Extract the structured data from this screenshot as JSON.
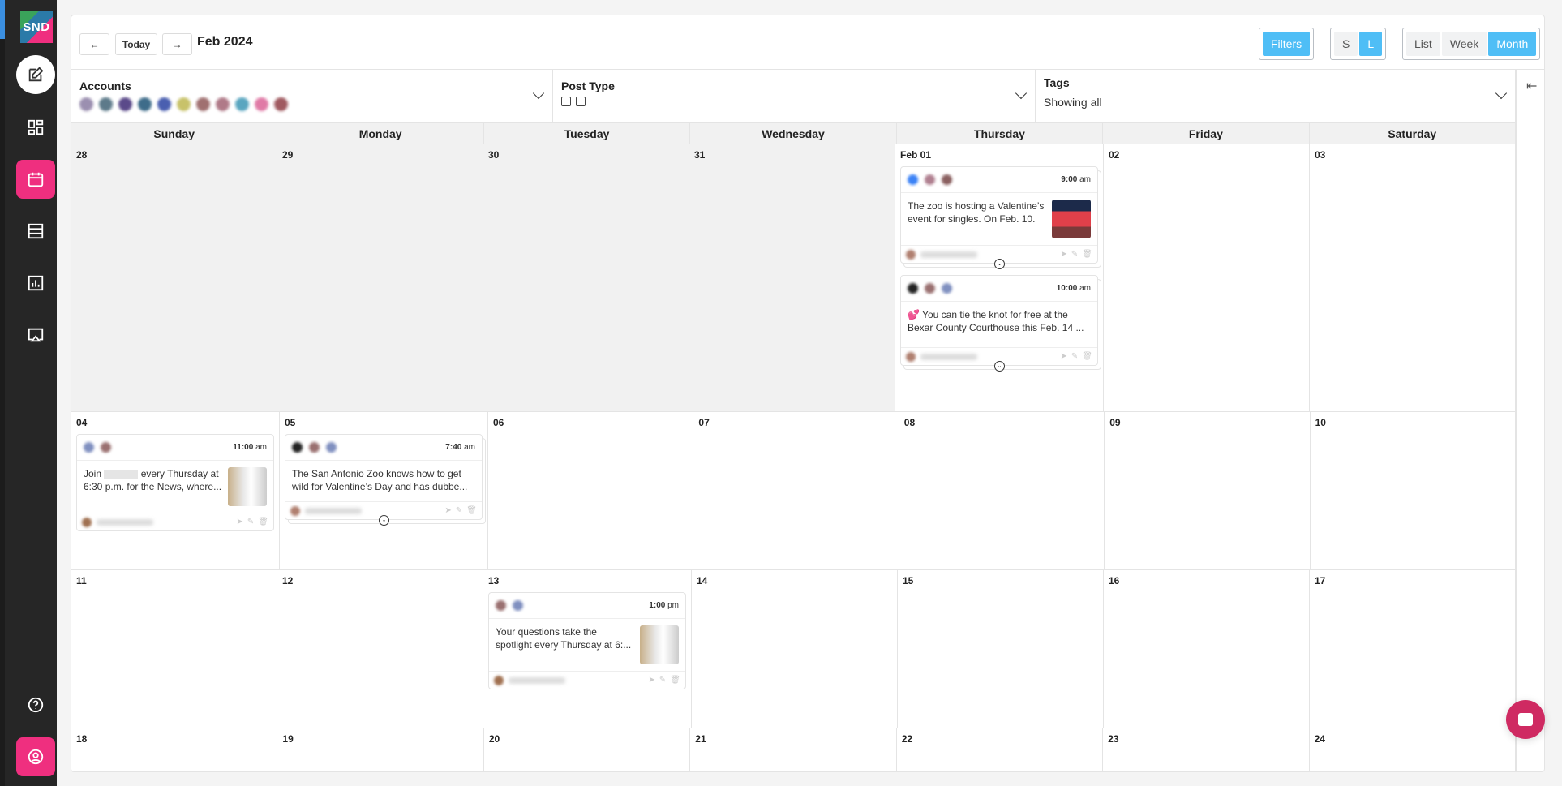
{
  "app": {
    "logo_text": "SND"
  },
  "sidebar": {
    "items": [
      {
        "name": "compose",
        "icon": "edit-icon"
      },
      {
        "name": "dashboard",
        "icon": "dashboard-icon"
      },
      {
        "name": "calendar",
        "icon": "calendar-icon",
        "active": true
      },
      {
        "name": "list",
        "icon": "list-icon"
      },
      {
        "name": "analytics",
        "icon": "chart-icon"
      },
      {
        "name": "screen",
        "icon": "cast-icon"
      },
      {
        "name": "help",
        "icon": "help-icon"
      },
      {
        "name": "profile",
        "icon": "user-icon"
      }
    ]
  },
  "toolbar": {
    "prev_label": "←",
    "today_label": "Today",
    "next_label": "→",
    "month_title": "Feb 2024",
    "filters_label": "Filters",
    "size": {
      "s": "S",
      "l": "L",
      "selected": "L"
    },
    "views": [
      "List",
      "Week",
      "Month"
    ],
    "selected_view": "Month"
  },
  "filters": {
    "accounts": {
      "label": "Accounts",
      "count": 11,
      "colors": [
        "#9b8fb0",
        "#5d7a8a",
        "#5b4a8a",
        "#3e6c8a",
        "#4a5fb0",
        "#c8c26a",
        "#a07070",
        "#b07a88",
        "#5aa6c0",
        "#e07aa6",
        "#a05a60"
      ]
    },
    "post_type": {
      "label": "Post Type"
    },
    "tags": {
      "label": "Tags",
      "value": "Showing all"
    }
  },
  "calendar": {
    "weekdays": [
      "Sunday",
      "Monday",
      "Tuesday",
      "Wednesday",
      "Thursday",
      "Friday",
      "Saturday"
    ],
    "weeks": [
      {
        "days": [
          "28",
          "29",
          "30",
          "31",
          "Feb 01",
          "02",
          "03"
        ],
        "past": [
          true,
          true,
          true,
          true,
          false,
          false,
          false
        ]
      },
      {
        "days": [
          "04",
          "05",
          "06",
          "07",
          "08",
          "09",
          "10"
        ]
      },
      {
        "days": [
          "11",
          "12",
          "13",
          "14",
          "15",
          "16",
          "17"
        ]
      },
      {
        "days": [
          "18",
          "19",
          "20",
          "21",
          "22",
          "23",
          "24"
        ]
      }
    ],
    "posts": {
      "feb01a": {
        "time": "9:00",
        "ampm": "am",
        "text": "The zoo is hosting a Valentine’s event for singles. On Feb. 10."
      },
      "feb01b": {
        "time": "10:00",
        "ampm": "am",
        "text": "💕 You can tie the knot for free at the Bexar County Courthouse this Feb. 14 ..."
      },
      "feb04": {
        "time": "11:00",
        "ampm": "am",
        "text_a": "Join",
        "text_b": "every Thursday at 6:30 p.m. for the News, where..."
      },
      "feb05": {
        "time": "7:40",
        "ampm": "am",
        "text": "The San Antonio Zoo knows how to get wild for Valentine’s Day and has dubbe..."
      },
      "feb13": {
        "time": "1:00",
        "ampm": "pm",
        "text": "Your questions take the spotlight every Thursday at 6:..."
      }
    }
  },
  "colors": {
    "accent": "#ef2f7f",
    "toggle_on": "#4fbef6",
    "chat": "#cf2a62"
  }
}
